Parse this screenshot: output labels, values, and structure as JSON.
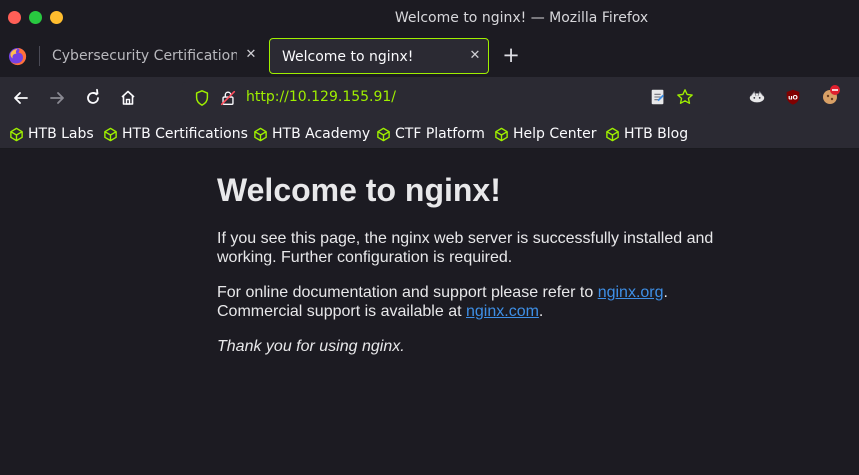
{
  "window": {
    "title": "Welcome to nginx! — Mozilla Firefox"
  },
  "tabs": [
    {
      "label": "Cybersecurity Certifications | ",
      "active": false
    },
    {
      "label": "Welcome to nginx!",
      "active": true
    }
  ],
  "navbar": {
    "url": "http://10.129.155.91/"
  },
  "bookmarks": [
    {
      "label": "HTB Labs"
    },
    {
      "label": "HTB Certifications"
    },
    {
      "label": "HTB Academy"
    },
    {
      "label": "CTF Platform"
    },
    {
      "label": "Help Center"
    },
    {
      "label": "HTB Blog"
    }
  ],
  "page": {
    "heading": "Welcome to nginx!",
    "para1": "If you see this page, the nginx web server is successfully installed and working. Further configuration is required.",
    "para2_prefix": "For online documentation and support please refer to ",
    "link1": "nginx.org",
    "para2_mid": ".",
    "para2_line2_prefix": "Commercial support is available at ",
    "link2": "nginx.com",
    "para2_suffix": ".",
    "thanks": "Thank you for using nginx."
  },
  "colors": {
    "accent": "#9fef00",
    "link": "#3e8fe6",
    "chrome": "#2b2a33",
    "background": "#1c1b22"
  }
}
